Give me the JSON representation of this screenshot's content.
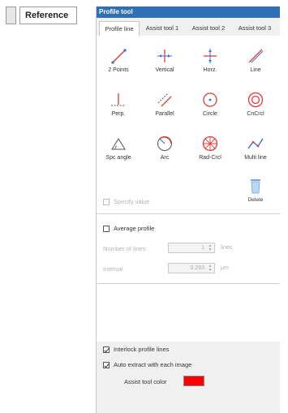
{
  "reference_tag": {
    "label": "Reference"
  },
  "window": {
    "title": "Profile tool"
  },
  "tabs": [
    {
      "label": "Profile line"
    },
    {
      "label": "Assist tool 1"
    },
    {
      "label": "Assist tool 2"
    },
    {
      "label": "Assist tool 3"
    }
  ],
  "tools": [
    {
      "label": "2 Points",
      "icon": "two-points-line-icon"
    },
    {
      "label": "Vertical",
      "icon": "vertical-profile-icon"
    },
    {
      "label": "Horz.",
      "icon": "horizontal-profile-icon"
    },
    {
      "label": "Line",
      "icon": "line-icon"
    },
    {
      "label": "Perp.",
      "icon": "perpendicular-icon"
    },
    {
      "label": "Parallel",
      "icon": "parallel-icon"
    },
    {
      "label": "Circle",
      "icon": "circle-icon"
    },
    {
      "label": "CnCrcl",
      "icon": "concentric-circle-icon"
    },
    {
      "label": "Spc angle",
      "icon": "specified-angle-icon"
    },
    {
      "label": "Arc",
      "icon": "arc-icon"
    },
    {
      "label": "Rad-Crcl",
      "icon": "radial-circle-icon"
    },
    {
      "label": "Multi line",
      "icon": "multi-line-icon"
    }
  ],
  "delete_button": {
    "label": "Delete"
  },
  "specify_value": {
    "label": "Specify value",
    "checked": false
  },
  "average_profile": {
    "label": "Average profile",
    "checked": false
  },
  "number_of_lines": {
    "label": "Number of lines",
    "value": "1",
    "unit": "lines"
  },
  "interval": {
    "label": "Interval",
    "value": "0.283",
    "unit": "μm"
  },
  "interlock": {
    "label": "Interlock profile lines",
    "checked": true
  },
  "auto_extract": {
    "label": "Auto extract with each image",
    "checked": true
  },
  "assist_color": {
    "label": "Assist tool color",
    "value": "#ff0000"
  },
  "accent_color": "#2f6fb6"
}
